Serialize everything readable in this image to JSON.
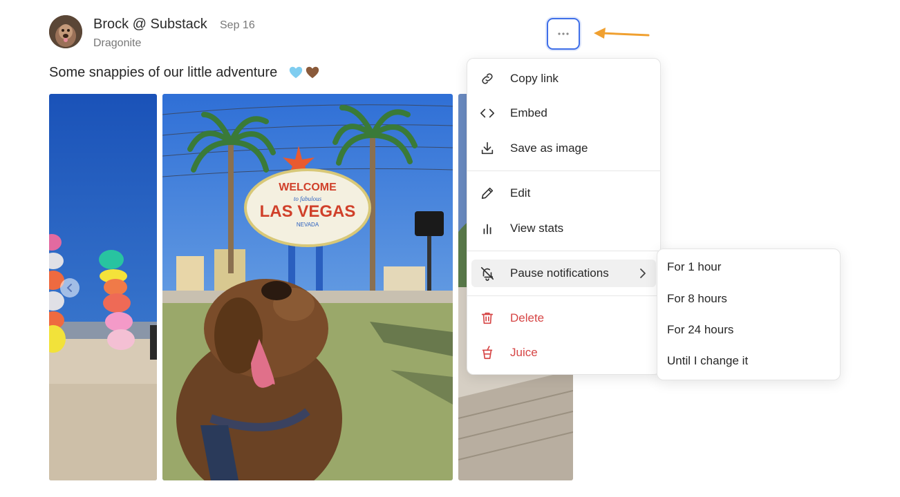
{
  "post": {
    "author_name": "Brock @ Substack",
    "date": "Sep 16",
    "publication": "Dragonite",
    "text": "Some snappies of our little adventure",
    "emojis": [
      "light-blue-heart-emoji",
      "brown-heart-emoji"
    ]
  },
  "gallery": {
    "photos": [
      {
        "name": "Seven Magic Mountains photo"
      },
      {
        "name": "Las Vegas sign dog photo",
        "sign_lines": [
          "WELCOME",
          "to fabulous",
          "LAS VEGAS",
          "NEVADA"
        ]
      },
      {
        "name": "Sidewalk photo"
      }
    ]
  },
  "menu": {
    "items": [
      {
        "label": "Copy link",
        "icon": "link-icon"
      },
      {
        "label": "Embed",
        "icon": "code-icon"
      },
      {
        "label": "Save as image",
        "icon": "download-icon"
      },
      {
        "label": "Edit",
        "icon": "pencil-icon"
      },
      {
        "label": "View stats",
        "icon": "bar-chart-icon"
      },
      {
        "label": "Pause notifications",
        "icon": "bell-off-icon"
      },
      {
        "label": "Delete",
        "icon": "trash-icon"
      },
      {
        "label": "Juice",
        "icon": "juice-cup-icon"
      }
    ]
  },
  "submenu": {
    "items": [
      {
        "label": "For 1 hour"
      },
      {
        "label": "For 8 hours"
      },
      {
        "label": "For 24 hours"
      },
      {
        "label": "Until I change it"
      }
    ]
  },
  "colors": {
    "accent_focus": "#3f6fe8",
    "annotation_arrow": "#f0a030",
    "danger": "#d64545"
  }
}
